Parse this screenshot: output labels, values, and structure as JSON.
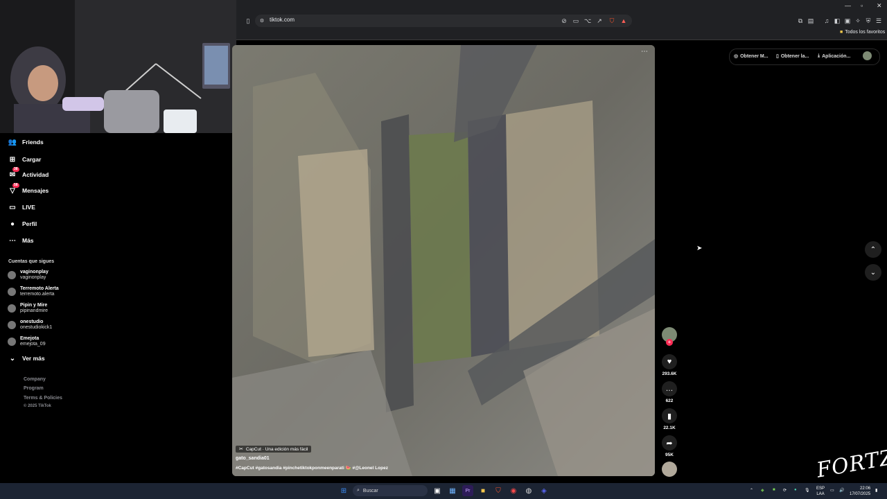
{
  "browser": {
    "url": "tiktok.com",
    "bookmarks_label": "Todos los favoritos"
  },
  "sidebar": {
    "nav": [
      {
        "label": "Friends",
        "icon": "friends-icon",
        "glyph": "👥"
      },
      {
        "label": "Cargar",
        "icon": "upload-icon",
        "glyph": "⊞"
      },
      {
        "label": "Actividad",
        "icon": "activity-icon",
        "glyph": "✉",
        "badge": "38"
      },
      {
        "label": "Mensajes",
        "icon": "messages-icon",
        "glyph": "▽",
        "badge": "58"
      },
      {
        "label": "LIVE",
        "icon": "live-icon",
        "glyph": "▭"
      },
      {
        "label": "Perfil",
        "icon": "profile-avatar-icon",
        "glyph": "●"
      },
      {
        "label": "Más",
        "icon": "more-icon",
        "glyph": "⋯"
      }
    ],
    "following_title": "Cuentas que sigues",
    "following": [
      {
        "name": "vaginonplay",
        "handle": "vaginonplay"
      },
      {
        "name": "Terremoto Alerta",
        "handle": "terremoto.alerta"
      },
      {
        "name": "Pipin y Mire",
        "handle": "pipinandmire"
      },
      {
        "name": "onestudio",
        "handle": "onestudiokick1"
      },
      {
        "name": "Emejota",
        "handle": "emejota_09"
      }
    ],
    "see_more": "Ver más",
    "footer": [
      "Company",
      "Program",
      "Terms & Policies"
    ],
    "copyright": "© 2025 TikTok"
  },
  "header": {
    "buttons": [
      "Obtener M...",
      "Obtener la...",
      "Aplicación..."
    ]
  },
  "video": {
    "capcut_label": "CapCut · Una edición más fácil",
    "author": "gato_sandia01",
    "caption": "#CapCut  #gatosandia  #pinchetiktokponmeenparati 🍉  #@Leonel Lopez"
  },
  "actions": {
    "likes": "293.6K",
    "comments": "622",
    "saves": "22.1K",
    "shares": "95K"
  },
  "taskbar": {
    "search_placeholder": "Buscar",
    "lang_top": "ESP",
    "lang_bottom": "LAA",
    "time": "22:06",
    "date": "17/07/2025"
  },
  "overlay": {
    "watermark": "FORTZ"
  }
}
